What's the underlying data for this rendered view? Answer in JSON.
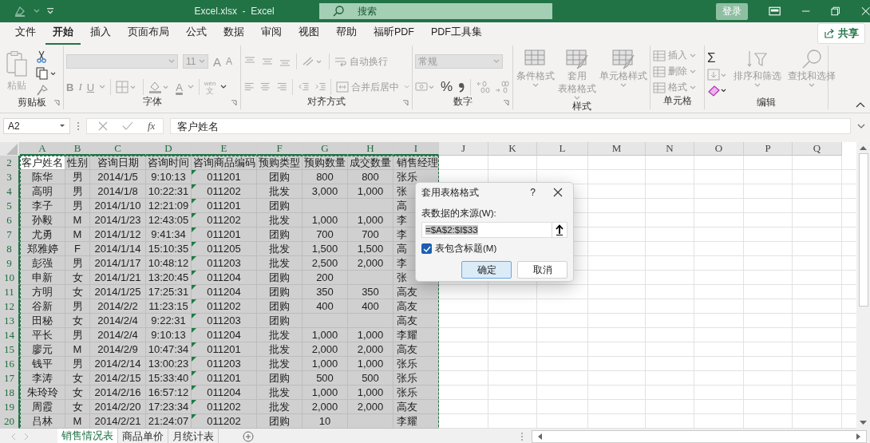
{
  "title_bar": {
    "title": "Excel.xlsx  -  Excel",
    "search_placeholder": "搜索",
    "sign_in_button": "登录"
  },
  "menu_tabs": [
    {
      "label": "文件",
      "selected": false
    },
    {
      "label": "开始",
      "selected": true
    },
    {
      "label": "插入",
      "selected": false
    },
    {
      "label": "页面布局",
      "selected": false
    },
    {
      "label": "公式",
      "selected": false
    },
    {
      "label": "数据",
      "selected": false
    },
    {
      "label": "审阅",
      "selected": false
    },
    {
      "label": "视图",
      "selected": false
    },
    {
      "label": "帮助",
      "selected": false
    },
    {
      "label": "福昕PDF",
      "selected": false
    },
    {
      "label": "PDF工具集",
      "selected": false
    }
  ],
  "share_button": "共享",
  "ribbon": {
    "clipboard": {
      "label": "剪贴板",
      "paste": "粘贴"
    },
    "font": {
      "label": "字体",
      "font_size": "11",
      "grow": "A",
      "shrink": "A",
      "styles": [
        {
          "label": "B",
          "kind": "bold"
        },
        {
          "label": "I",
          "kind": "italic"
        },
        {
          "label": "U",
          "kind": "underline"
        }
      ],
      "font_color": "A",
      "phonetic_top": "wén",
      "phonetic_bottom": "文"
    },
    "alignment": {
      "label": "对齐方式",
      "wrap_text": "自动换行",
      "merge_center": "合并后居中"
    },
    "number": {
      "label": "数字",
      "format": "常规",
      "percent": "%"
    },
    "styles": {
      "label": "样式",
      "buttons": [
        {
          "lines": [
            "条件格式"
          ]
        },
        {
          "lines": [
            "套用",
            "表格格式"
          ]
        },
        {
          "lines": [
            "单元格样式"
          ]
        }
      ]
    },
    "cells": {
      "label": "单元格",
      "buttons": [
        "插入",
        "删除",
        "格式"
      ]
    },
    "editing": {
      "label": "编辑",
      "sum": "Σ",
      "buttons": [
        "排序和筛选",
        "查找和选择"
      ]
    }
  },
  "formula_bar": {
    "name_box": "A2",
    "fx": "fx",
    "formula": "客户姓名"
  },
  "grid": {
    "columns": [
      {
        "label": "A",
        "selected": true
      },
      {
        "label": "B",
        "selected": true
      },
      {
        "label": "C",
        "selected": true
      },
      {
        "label": "D",
        "selected": true
      },
      {
        "label": "E",
        "selected": true
      },
      {
        "label": "F",
        "selected": true
      },
      {
        "label": "G",
        "selected": true
      },
      {
        "label": "H",
        "selected": true
      },
      {
        "label": "I",
        "selected": true
      },
      {
        "label": "J",
        "selected": false
      },
      {
        "label": "K",
        "selected": false
      },
      {
        "label": "L",
        "selected": false
      },
      {
        "label": "M",
        "selected": false
      },
      {
        "label": "N",
        "selected": false
      },
      {
        "label": "O",
        "selected": false
      },
      {
        "label": "P",
        "selected": false
      },
      {
        "label": "Q",
        "selected": false
      }
    ],
    "rows": [
      {
        "number": "2",
        "selected": true,
        "active": true,
        "flagged": false,
        "cells": [
          "客户姓名",
          "性别",
          "咨询日期",
          "咨询时间",
          "咨询商品编码",
          "预购类型",
          "预购数量",
          "成交数量",
          "销售经理"
        ]
      },
      {
        "number": "3",
        "selected": true,
        "flagged": true,
        "cells": [
          "陈华",
          "男",
          "2014/1/5",
          "9:10:13",
          "011201",
          "团购",
          "800",
          "800",
          "张乐"
        ]
      },
      {
        "number": "4",
        "selected": true,
        "flagged": true,
        "cells": [
          "高明",
          "男",
          "2014/1/8",
          "10:22:31",
          "011202",
          "批发",
          "3,000",
          "1,000",
          "张"
        ]
      },
      {
        "number": "5",
        "selected": true,
        "flagged": true,
        "cells": [
          "李子",
          "男",
          "2014/1/10",
          "12:21:09",
          "011201",
          "团购",
          "",
          "",
          "高"
        ]
      },
      {
        "number": "6",
        "selected": true,
        "flagged": true,
        "cells": [
          "孙毅",
          "M",
          "2014/1/23",
          "12:43:05",
          "011202",
          "批发",
          "1,000",
          "1,000",
          "李"
        ]
      },
      {
        "number": "7",
        "selected": true,
        "flagged": true,
        "cells": [
          "尤勇",
          "M",
          "2014/1/12",
          "9:41:34",
          "011201",
          "团购",
          "700",
          "700",
          "李"
        ]
      },
      {
        "number": "8",
        "selected": true,
        "flagged": true,
        "cells": [
          "郑雅婷",
          "F",
          "2014/1/14",
          "15:10:35",
          "011205",
          "批发",
          "1,500",
          "1,500",
          "高"
        ]
      },
      {
        "number": "9",
        "selected": true,
        "flagged": true,
        "cells": [
          "彭强",
          "男",
          "2014/1/17",
          "10:48:12",
          "011203",
          "批发",
          "2,500",
          "2,000",
          "李"
        ]
      },
      {
        "number": "10",
        "selected": true,
        "flagged": true,
        "cells": [
          "申新",
          "女",
          "2014/1/21",
          "13:20:45",
          "011204",
          "团购",
          "200",
          "",
          "张"
        ]
      },
      {
        "number": "11",
        "selected": true,
        "flagged": true,
        "cells": [
          "方明",
          "女",
          "2014/1/25",
          "17:25:31",
          "011204",
          "团购",
          "350",
          "350",
          "高友"
        ]
      },
      {
        "number": "12",
        "selected": true,
        "flagged": true,
        "cells": [
          "谷新",
          "男",
          "2014/2/2",
          "11:23:15",
          "011202",
          "团购",
          "400",
          "400",
          "高友"
        ]
      },
      {
        "number": "13",
        "selected": true,
        "flagged": true,
        "cells": [
          "田秘",
          "女",
          "2014/2/4",
          "9:22:31",
          "011203",
          "团购",
          "",
          "",
          "高友"
        ]
      },
      {
        "number": "14",
        "selected": true,
        "flagged": true,
        "cells": [
          "平长",
          "男",
          "2014/2/4",
          "9:10:13",
          "011204",
          "批发",
          "1,000",
          "1,000",
          "李耀"
        ]
      },
      {
        "number": "15",
        "selected": true,
        "flagged": true,
        "cells": [
          "廖元",
          "M",
          "2014/2/9",
          "10:47:34",
          "011201",
          "批发",
          "2,000",
          "2,000",
          "高友"
        ]
      },
      {
        "number": "16",
        "selected": true,
        "flagged": true,
        "cells": [
          "钱平",
          "男",
          "2014/2/14",
          "13:00:23",
          "011203",
          "批发",
          "1,000",
          "1,000",
          "张乐"
        ]
      },
      {
        "number": "17",
        "selected": true,
        "flagged": true,
        "cells": [
          "李涛",
          "女",
          "2014/2/15",
          "15:33:40",
          "011201",
          "团购",
          "500",
          "500",
          "张乐"
        ]
      },
      {
        "number": "18",
        "selected": true,
        "flagged": true,
        "cells": [
          "朱玲玲",
          "女",
          "2014/2/16",
          "16:57:12",
          "011204",
          "批发",
          "1,000",
          "1,000",
          "张乐"
        ]
      },
      {
        "number": "19",
        "selected": true,
        "flagged": true,
        "cells": [
          "周霞",
          "女",
          "2014/2/20",
          "17:23:34",
          "011202",
          "批发",
          "2,000",
          "2,000",
          "高友"
        ]
      },
      {
        "number": "20",
        "selected": true,
        "flagged": true,
        "cells": [
          "吕林",
          "M",
          "2014/2/21",
          "21:24:07",
          "011202",
          "团购",
          "10",
          "",
          "李耀"
        ]
      }
    ]
  },
  "dialog": {
    "title": "套用表格格式",
    "help": "?",
    "source_label": "表数据的来源(W):",
    "source_value": "=$A$2:$I$33",
    "has_headers": {
      "label": "表包含标题(M)",
      "checked": true
    },
    "ok_button": "确定",
    "cancel_button": "取消"
  },
  "sheet_tabs": [
    {
      "label": "销售情况表",
      "selected": true
    },
    {
      "label": "商品单价",
      "selected": false
    },
    {
      "label": "月统计表",
      "selected": false
    }
  ]
}
